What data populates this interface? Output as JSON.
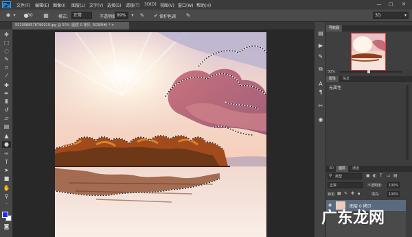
{
  "app": {
    "logo": "Ps"
  },
  "menu": [
    "文件(F)",
    "编辑(E)",
    "图像(I)",
    "图层(L)",
    "文字(Y)",
    "选择(S)",
    "滤镜(T)",
    "3D(D)",
    "视图(V)",
    "窗口(W)",
    "帮助(H)"
  ],
  "window_controls": [
    "—",
    "□",
    "✕"
  ],
  "options": {
    "size_value": "30",
    "mode_label": "模式:",
    "mode_value": "正常",
    "opacity_label": "不透明度:",
    "opacity_value": "99%",
    "flow_label": "流量:",
    "protect_label": "保护色调",
    "workspace": "3D"
  },
  "document": {
    "tab_title": "552998857879091​0.jpg @ 50% (图层 0 拷贝, RGB/8#) * ×"
  },
  "panels": {
    "navigator_tab": "导航器",
    "zoom": "50%",
    "properties_tab": "属性",
    "info_tab": "信息",
    "properties_empty": "无属性",
    "layers_tabs": [
      "3D",
      "图层",
      "通道"
    ],
    "filter_kind": "类型",
    "blend_mode": "正常",
    "opacity_label": "不透明度:",
    "opacity_value": "100%",
    "lock_label": "锁定:",
    "fill_label": "填充:",
    "fill_value": "100%",
    "layer_name": "图层 0 拷贝"
  },
  "colors": {
    "foreground": "#1d2bff",
    "background": "#ffffff",
    "accent": "#3da8f5"
  },
  "watermark": "广东龙网"
}
